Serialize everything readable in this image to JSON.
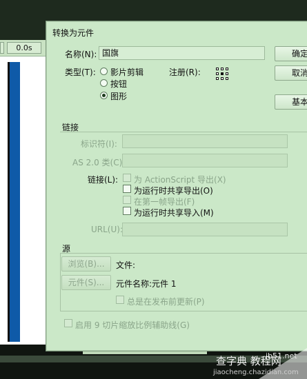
{
  "background": {
    "time_display": "0.0s"
  },
  "dialog": {
    "title": "转换为元件",
    "name_label": "名称(N):",
    "name_value": "国旗",
    "type_label": "类型(T):",
    "type_options": [
      "影片剪辑",
      "按钮",
      "图形"
    ],
    "type_selected": "图形",
    "registration_label": "注册(R):",
    "ok_button": "确定",
    "cancel_button": "取消",
    "basic_button": "基本",
    "linkage_section": "链接",
    "identifier_label": "标识符(I):",
    "as_class_label": "AS 2.0 类(C):",
    "linkage_label": "链接(L):",
    "linkage_checks": [
      "为 ActionScript 导出(X)",
      "为运行时共享导出(O)",
      "在第一帧导出(F)",
      "为运行时共享导入(M)"
    ],
    "url_label": "URL(U):",
    "source_section": "源",
    "browse_button": "浏览(B)...",
    "file_label": "文件:",
    "symbol_button": "元件(S)...",
    "symbol_name_text": "元件名称:元件 1",
    "always_update_label": "总是在发布前更新(P)",
    "guides_label": "启用 9 切片缩放比例辅助线(G)"
  },
  "watermark": {
    "line1": "查字典 教程网",
    "line2": "jiaocheng.chazidian.com",
    "site": "jb51.net"
  }
}
